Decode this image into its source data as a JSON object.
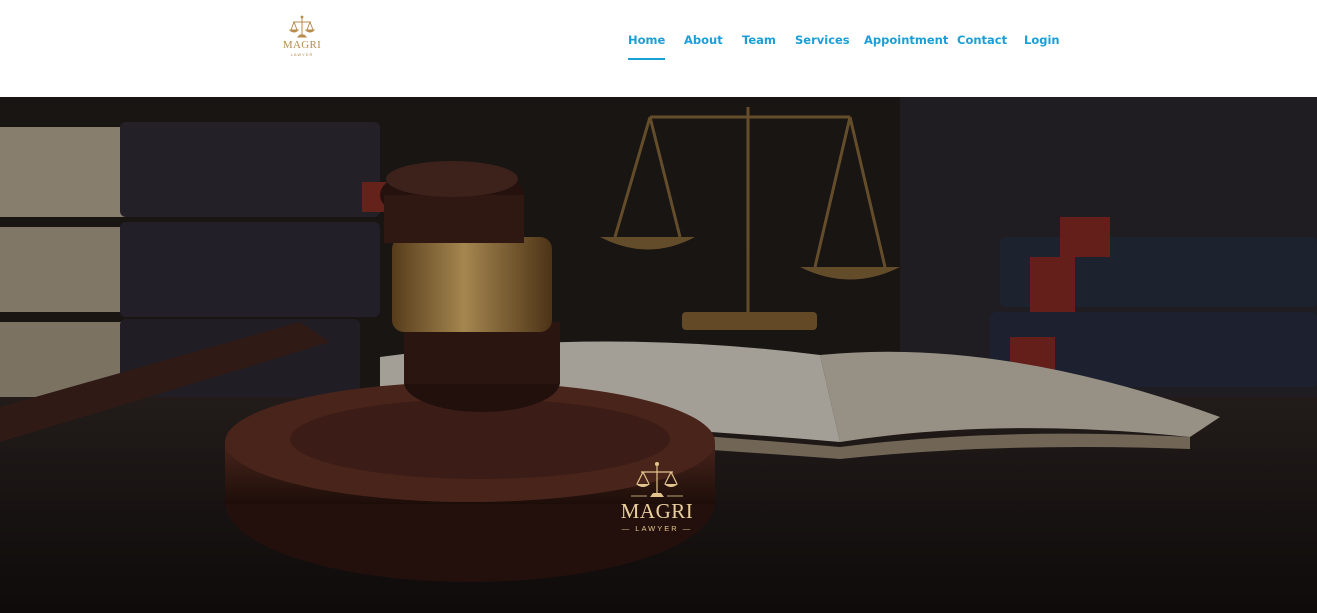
{
  "header": {
    "brand": {
      "title": "MAGRI",
      "subtitle": "LAWYER",
      "icon": "scales-of-justice-icon"
    },
    "nav": [
      {
        "label": "Home",
        "active": true
      },
      {
        "label": "About",
        "active": false
      },
      {
        "label": "Team",
        "active": false
      },
      {
        "label": "Services",
        "active": false
      },
      {
        "label": "Appointment",
        "active": false
      },
      {
        "label": "Contact",
        "active": false
      },
      {
        "label": "Login",
        "active": false
      }
    ]
  },
  "hero": {
    "logo": {
      "title": "MAGRI",
      "subtitle": "— LAWYER —",
      "icon": "scales-of-justice-icon"
    },
    "background": "gavel-and-law-books-photo"
  },
  "colors": {
    "nav_link": "#1a9fd6",
    "brand_gold": "#b98a4e",
    "hero_gold": "#e2c48e"
  }
}
